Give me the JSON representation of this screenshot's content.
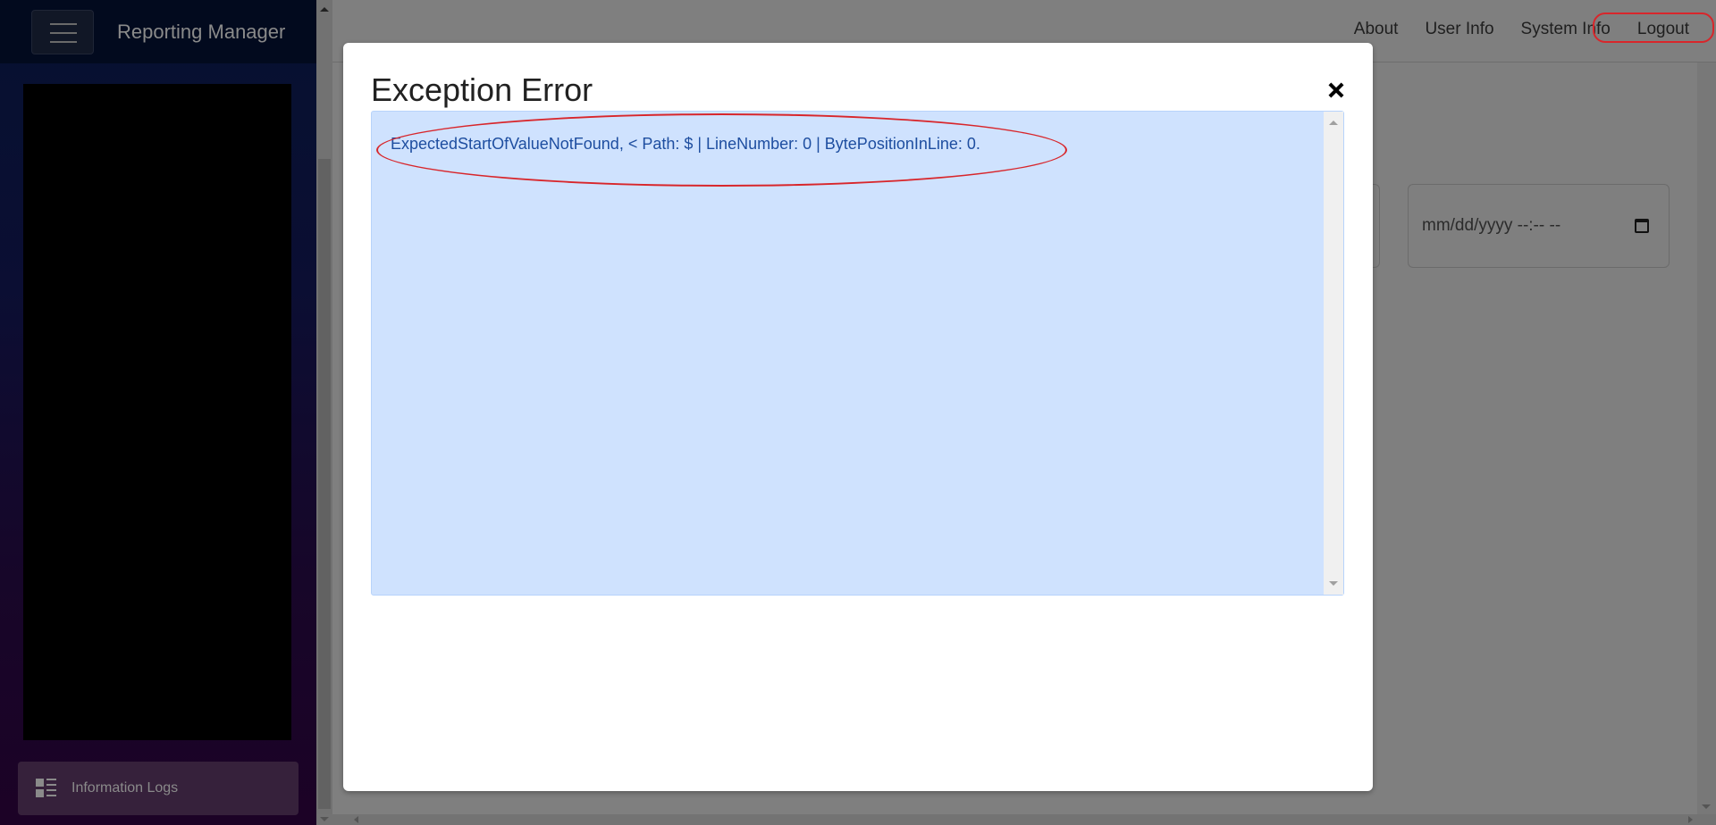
{
  "app": {
    "title": "Reporting Manager"
  },
  "sidebar": {
    "menu_icon": "hamburger-icon",
    "items": [
      {
        "label": "Information Logs",
        "icon": "list-view-icon"
      }
    ]
  },
  "topnav": {
    "links": [
      {
        "label": "About"
      },
      {
        "label": "User Info"
      },
      {
        "label": "System Info"
      },
      {
        "label": "Logout"
      }
    ],
    "highlighted": "Logout"
  },
  "page": {
    "date_input": {
      "placeholder": "mm/dd/yyyy --:-- --",
      "icon": "calendar-icon"
    }
  },
  "modal": {
    "title": "Exception Error",
    "close_icon": "close-icon",
    "message": "ExpectedStartOfValueNotFound, < Path: $ | LineNumber: 0 | BytePositionInLine: 0.",
    "highlight_color": "#d8262b",
    "message_color": "#1e4ea0",
    "message_bg": "#cfe2fe"
  }
}
